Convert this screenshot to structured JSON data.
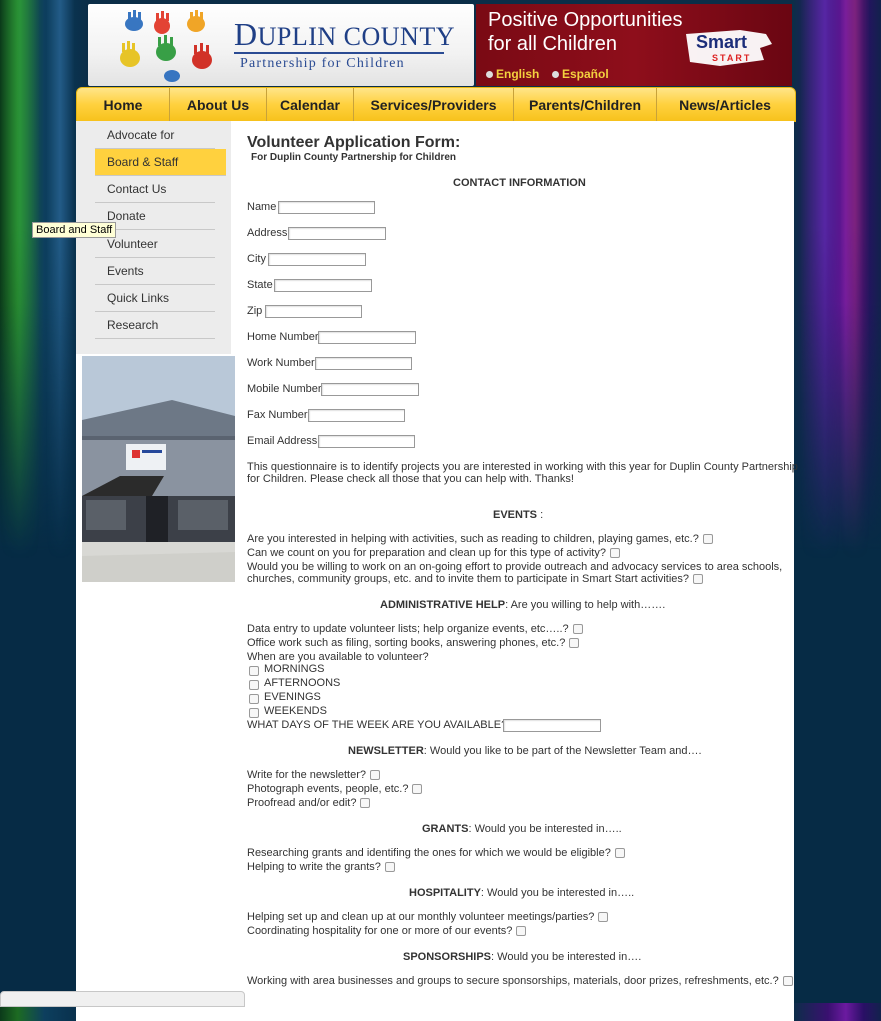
{
  "header": {
    "logo_title_first": "D",
    "logo_title_rest": "UPLIN COUNTY",
    "logo_subtitle": "Partnership for Children",
    "tagline_line1": "Positive Opportunities",
    "tagline_line2": "for all Children",
    "lang_english": "English",
    "lang_espanol": "Español",
    "smart_word": "Smart",
    "start_word": "START"
  },
  "nav": {
    "items": [
      "Home",
      "About Us",
      "Calendar",
      "Services/Providers",
      "Parents/Children",
      "News/Articles"
    ]
  },
  "sidebar": {
    "items": [
      "Advocate for Children",
      "Board & Staff",
      "Contact Us",
      "Donate",
      "Volunteer",
      "Events",
      "Quick Links",
      "Research"
    ],
    "active_index": 1,
    "tooltip": "Board and Staff"
  },
  "form": {
    "title": "Volunteer Application Form:",
    "subtitle": "For Duplin County Partnership for Children",
    "contact_heading": "CONTACT INFORMATION",
    "fields": [
      "Name",
      "Address",
      "City",
      "State",
      "Zip",
      "Home Number",
      "Work Number",
      "Mobile Number",
      "Fax Number",
      "Email Address"
    ],
    "intro_line1": "This questionnaire is to identify projects you are interested in working with this year for Duplin County Partnership",
    "intro_line2": "for Children. Please check all those that you can help with. Thanks!",
    "events_heading": "EVENTS",
    "events_suffix": " :",
    "events_q1": "Are you interested in helping with activities, such as reading to children, playing games, etc.?",
    "events_q2": "Can we count on you for preparation and clean up for this type of activity?",
    "events_q3_line1": "Would you be willing to work on an on-going effort to provide outreach and advocacy services to area schools,",
    "events_q3_line2": "churches, community groups, etc. and to invite them to participate in Smart Start activities?",
    "admin_heading": "ADMINISTRATIVE HELP",
    "admin_suffix": ": Are you willing to help with…….",
    "admin_q1": "Data entry to update volunteer lists; help organize events, etc…..?",
    "admin_q2": "Office work such as filing, sorting books, answering phones, etc.?",
    "admin_q3": "When are you available to volunteer?",
    "times": [
      "MORNINGS",
      "AFTERNOONS",
      "EVENINGS",
      "WEEKENDS"
    ],
    "days_label": "WHAT DAYS OF THE WEEK ARE YOU AVAILABLE?",
    "newsletter_heading": "NEWSLETTER",
    "newsletter_suffix": ": Would you like to be part of the Newsletter Team and….",
    "newsletter_q": [
      "Write for the newsletter?",
      "Photograph events, people, etc.?",
      "Proofread and/or edit?"
    ],
    "grants_heading": "GRANTS",
    "grants_suffix": ": Would you be interested in…..",
    "grants_q": [
      "Researching grants and identifing the ones for which we would be eligible?",
      "Helping to write the grants?"
    ],
    "hosp_heading": "HOSPITALITY",
    "hosp_suffix": ": Would you be interested in…..",
    "hosp_q": [
      "Helping set up and clean up at our monthly volunteer meetings/parties?",
      "Coordinating hospitality for one or more of our events?"
    ],
    "spons_heading": "SPONSORSHIPS",
    "spons_suffix": ": Would you be interested in….",
    "spons_q": "Working with area businesses and groups to secure sponsorships, materials, door prizes, refreshments, etc.?"
  }
}
